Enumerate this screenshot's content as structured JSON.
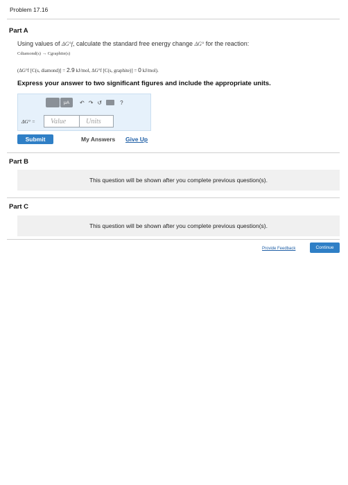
{
  "problem": {
    "title": "Problem 17.16"
  },
  "part_a": {
    "title": "Part A",
    "question_pre": "Using values of ",
    "symbol_dgf": "ΔG°f",
    "question_mid": ", calculate the standard free energy change ",
    "symbol_dg": "ΔG°",
    "question_post": " for the reaction:",
    "reaction": "Cdiamond(s) → Cgraphite(s)",
    "data_open": "(ΔG°f [C(s, diamond)] = ",
    "data_value_1": "2.9",
    "data_unit_1": " kJ/mol, ΔG°f [C(s, graphite)] = ",
    "data_value_2": "0",
    "data_unit_2": " kJ/mol).",
    "instruction": "Express your answer to two significant figures and include the appropriate units.",
    "answer_label": "ΔG° =",
    "value_placeholder": "Value",
    "units_placeholder": "Units",
    "toolbar": {
      "mu_label": "μA",
      "undo": "↶",
      "redo": "↷",
      "reset": "↺",
      "help": "?"
    },
    "submit_label": "Submit",
    "my_answers_label": "My Answers",
    "give_up_label": "Give Up"
  },
  "part_b": {
    "title": "Part B",
    "locked_message": "This question will be shown after you complete previous question(s)."
  },
  "part_c": {
    "title": "Part C",
    "locked_message": "This question will be shown after you complete previous question(s)."
  },
  "footer": {
    "feedback_label": "Provide Feedback",
    "continue_label": "Continue"
  }
}
